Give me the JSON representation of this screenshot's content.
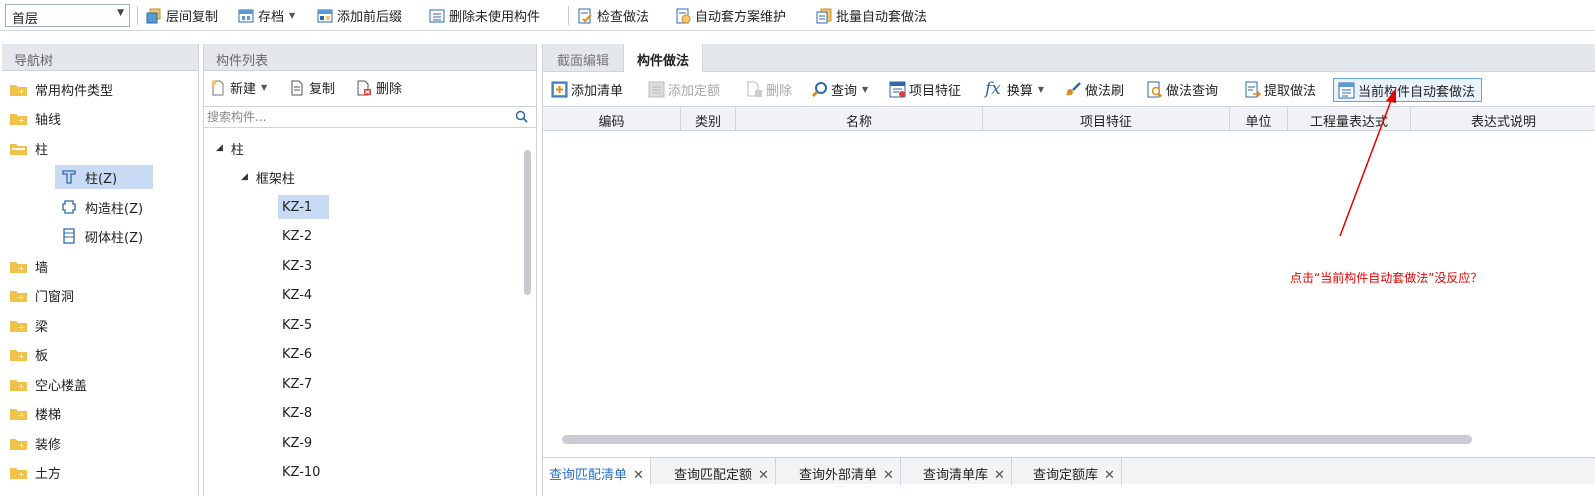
{
  "toolbar": {
    "floor_value": "首层",
    "items": [
      "层间复制",
      "存档",
      "添加前后缀",
      "删除未使用构件",
      "检查做法",
      "自动套方案维护",
      "批量自动套做法"
    ]
  },
  "nav": {
    "title": "导航树",
    "items": [
      "常用构件类型",
      "轴线",
      "柱",
      "柱(Z)",
      "构造柱(Z)",
      "砌体柱(Z)",
      "墙",
      "门窗洞",
      "梁",
      "板",
      "空心楼盖",
      "楼梯",
      "装修",
      "土方"
    ]
  },
  "comp": {
    "title": "构件列表",
    "new_label": "新建",
    "copy_label": "复制",
    "delete_label": "删除",
    "search_placeholder": "搜索构件...",
    "tree_root": "柱",
    "tree_group": "框架柱",
    "items": [
      "KZ-1",
      "KZ-2",
      "KZ-3",
      "KZ-4",
      "KZ-5",
      "KZ-6",
      "KZ-7",
      "KZ-8",
      "KZ-9",
      "KZ-10"
    ]
  },
  "main": {
    "tabs": [
      "截面编辑",
      "构件做法"
    ],
    "toolbar": [
      "添加清单",
      "添加定额",
      "删除",
      "查询",
      "项目特征",
      "换算",
      "做法刷",
      "做法查询",
      "提取做法",
      "当前构件自动套做法"
    ],
    "columns": [
      "编码",
      "类别",
      "名称",
      "项目特征",
      "单位",
      "工程量表达式",
      "表达式说明"
    ],
    "bottom_tabs": [
      "查询匹配清单",
      "查询匹配定额",
      "查询外部清单",
      "查询清单库",
      "查询定额库"
    ],
    "fx_symbol": "fx"
  },
  "annotation": "点击“当前构件自动套做法”没反应？",
  "colors": {
    "accent": "#2a6fc9",
    "annotation": "#e00000",
    "selection": "#c8daf4",
    "folder": "#f0c24a"
  }
}
